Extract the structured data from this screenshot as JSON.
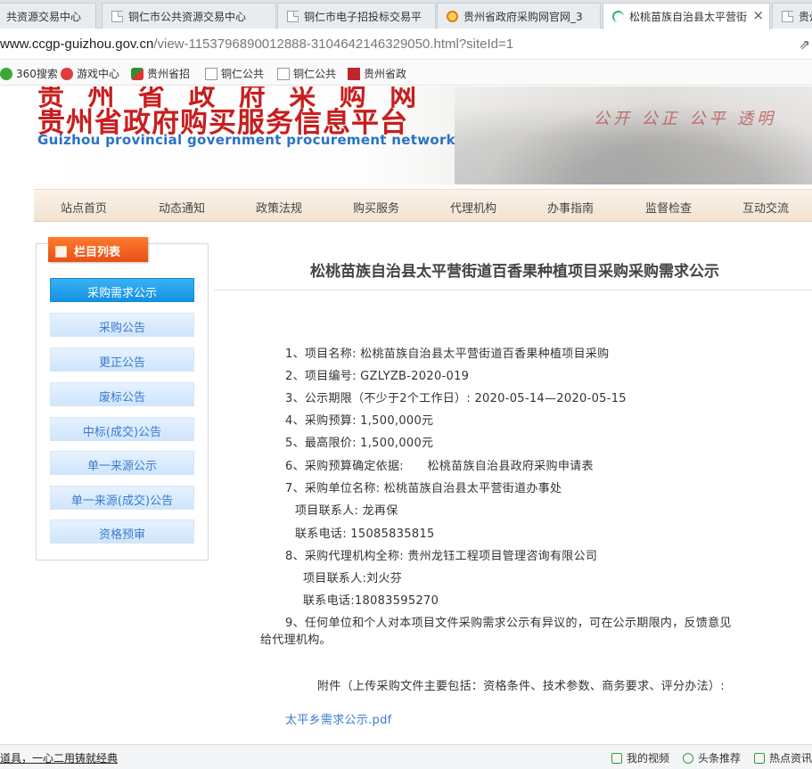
{
  "browser": {
    "tabs": [
      {
        "label": "共资源交易中心"
      },
      {
        "label": "铜仁市公共资源交易中心"
      },
      {
        "label": "铜仁市电子招投标交易平"
      },
      {
        "label": "贵州省政府采购网官网_3"
      },
      {
        "label": "松桃苗族自治县太平营街"
      },
      {
        "label": "贵州"
      }
    ],
    "close_glyph": "×",
    "address": {
      "host": "www.ccgp-guizhou.gov.cn",
      "path": "/view-1153796890012888-3104642146329050.html?siteId=1"
    },
    "bookmarks": [
      {
        "label": "360搜索",
        "icon": "360-icon"
      },
      {
        "label": "游戏中心",
        "icon": "game-icon"
      },
      {
        "label": "贵州省招",
        "icon": "gov-icon"
      },
      {
        "label": "铜仁公共",
        "icon": "page-icon"
      },
      {
        "label": "铜仁公共",
        "icon": "page-icon"
      },
      {
        "label": "贵州省政",
        "icon": "red-icon"
      }
    ]
  },
  "site": {
    "title_top": "贵 州 省 政 府 采 购 网",
    "title_cn": "贵州省政府购买服务信息平台",
    "title_en": "Guizhou provincial government procurement network",
    "slogan": "公开 公正 公平 透明"
  },
  "nav": [
    "站点首页",
    "动态通知",
    "政策法规",
    "购买服务",
    "代理机构",
    "办事指南",
    "监督检查",
    "互动交流"
  ],
  "sidebar": {
    "title": "栏目列表",
    "items": [
      "采购需求公示",
      "采购公告",
      "更正公告",
      "废标公告",
      "中标(成交)公告",
      "单一来源公示",
      "单一来源(成交)公告",
      "资格预审"
    ]
  },
  "article": {
    "title": "松桃苗族自治县太平营街道百香果种植项目采购采购需求公示",
    "lines": [
      "1、项目名称: 松桃苗族自治县太平营街道百香果种植项目采购",
      "2、项目编号: GZLYZB-2020-019",
      "3、公示期限（不少于2个工作日）: 2020-05-14—2020-05-15",
      "4、采购预算: 1,500,000元",
      "5、最高限价: 1,500,000元",
      "6、采购预算确定依据:      松桃苗族自治县政府采购申请表",
      "7、采购单位名称: 松桃苗族自治县太平营街道办事处",
      "项目联系人: 龙再保",
      "联系电话: 15085835815",
      "8、采购代理机构全称: 贵州龙钰工程项目管理咨询有限公司",
      "项目联系人:刘火芬",
      "联系电话:18083595270",
      "9、任何单位和个人对本项目文件采购需求公示有异议的，可在公示期限内，反馈意见",
      "给代理机构。",
      "附件（上传采购文件主要包括：资格条件、技术参数、商务要求、评分办法）:",
      "太平乡需求公示.pdf"
    ]
  },
  "statusbar": {
    "left": "道具，一心二用铸就经典",
    "items": [
      "我的视频",
      "头条推荐",
      "热点资讯"
    ]
  }
}
